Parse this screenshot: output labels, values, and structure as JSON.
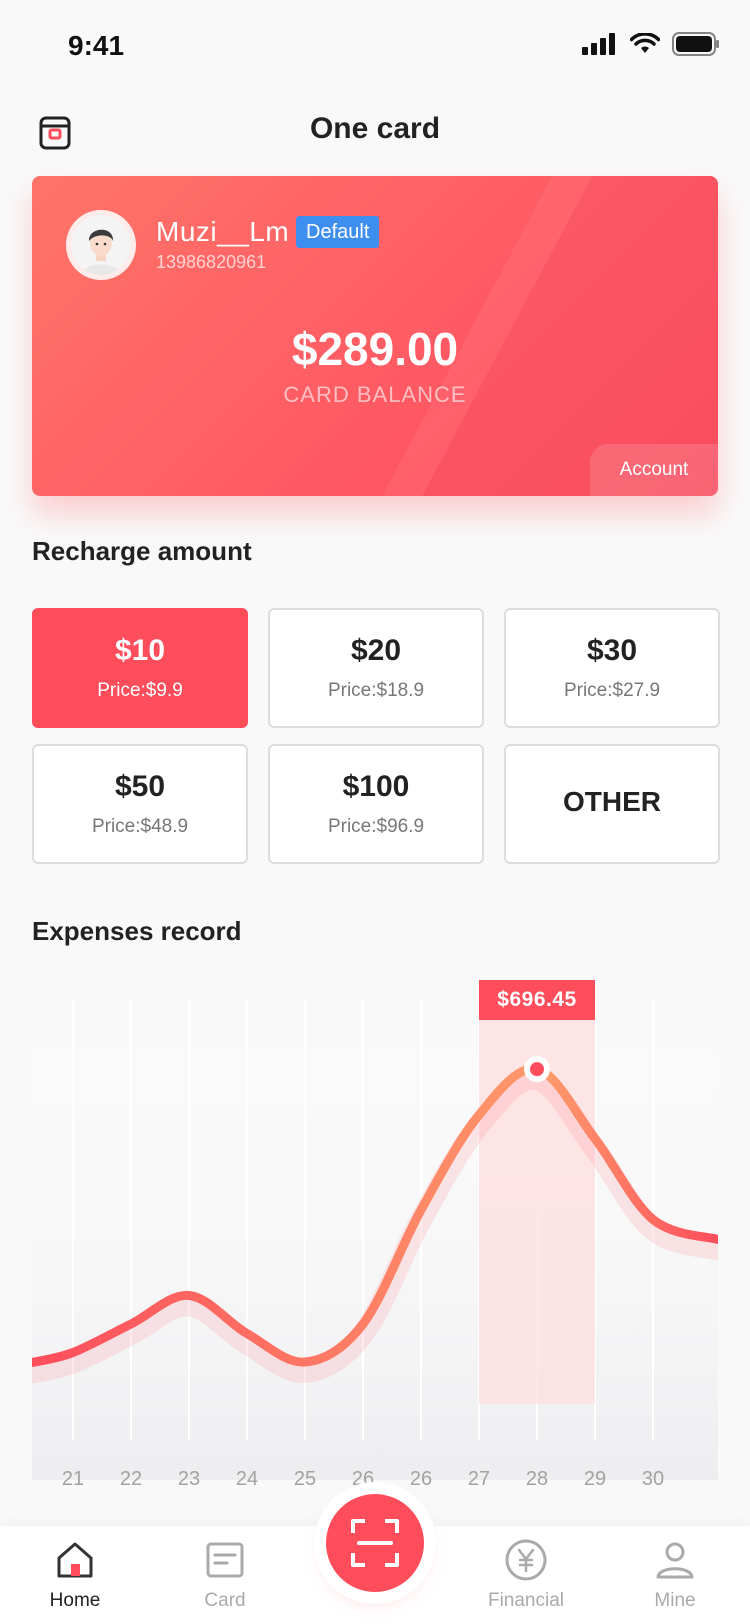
{
  "status_bar": {
    "time": "9:41"
  },
  "header": {
    "title": "One card"
  },
  "card": {
    "user_name": "Muzi__Lm",
    "badge": "Default",
    "phone": "13986820961",
    "balance": "$289.00",
    "balance_label": "CARD BALANCE",
    "account_label": "Account"
  },
  "recharge": {
    "title": "Recharge amount",
    "options": [
      {
        "value": "$10",
        "price": "Price:$9.9",
        "selected": true
      },
      {
        "value": "$20",
        "price": "Price:$18.9",
        "selected": false
      },
      {
        "value": "$30",
        "price": "Price:$27.9",
        "selected": false
      },
      {
        "value": "$50",
        "price": "Price:$48.9",
        "selected": false
      },
      {
        "value": "$100",
        "price": "Price:$96.9",
        "selected": false
      }
    ],
    "other_label": "OTHER"
  },
  "expenses": {
    "title": "Expenses record",
    "tooltip": "$696.45"
  },
  "chart_data": {
    "type": "line",
    "x": [
      "21",
      "22",
      "23",
      "24",
      "25",
      "26",
      "26",
      "27",
      "28",
      "29",
      "30"
    ],
    "values": [
      100,
      160,
      220,
      140,
      80,
      160,
      400,
      600,
      696.45,
      550,
      380
    ],
    "highlight_index": 8,
    "highlight_label": "$696.45",
    "xlabel": "",
    "ylabel": "",
    "ylim": [
      0,
      800
    ],
    "grid": "vertical",
    "colors": {
      "line_start": "#ff4d5c",
      "line_end": "#ff9a6a",
      "highlight": "#ffdede"
    }
  },
  "nav": {
    "items": [
      {
        "label": "Home",
        "icon": "home-icon",
        "active": true
      },
      {
        "label": "Card",
        "icon": "card-icon",
        "active": false
      },
      {
        "label": "Financial",
        "icon": "yen-coin-icon",
        "active": false
      },
      {
        "label": "Mine",
        "icon": "user-icon",
        "active": false
      }
    ],
    "scan_icon": "scan-icon"
  },
  "colors": {
    "accent": "#ff4d5c",
    "badge": "#3e8ef0",
    "text": "#222222",
    "muted": "#aaaaaa"
  }
}
